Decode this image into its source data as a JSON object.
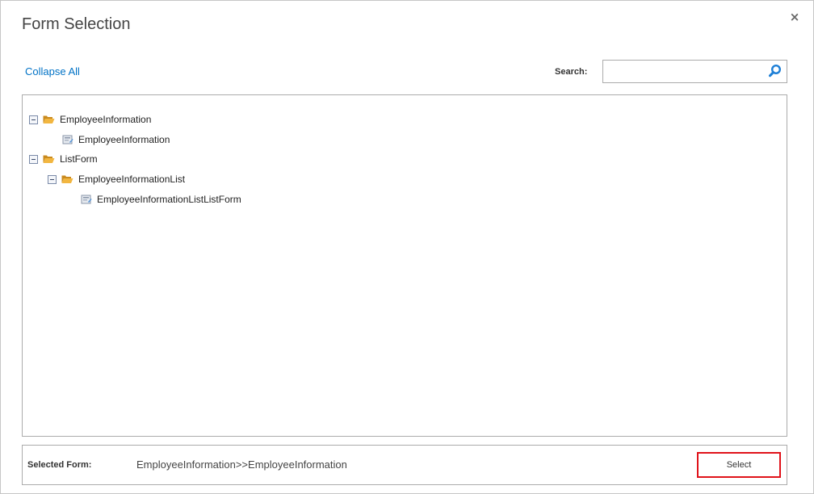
{
  "dialog": {
    "title": "Form Selection",
    "close_glyph": "×"
  },
  "toolbar": {
    "collapse_all": "Collapse All",
    "search_label": "Search:",
    "search_value": "",
    "search_icon": "search-icon"
  },
  "tree": [
    {
      "label": "EmployeeInformation",
      "type": "folder",
      "expanded": true,
      "depth": 0
    },
    {
      "label": "EmployeeInformation",
      "type": "form",
      "depth": 1
    },
    {
      "label": "ListForm",
      "type": "folder",
      "expanded": true,
      "depth": 0
    },
    {
      "label": "EmployeeInformationList",
      "type": "folder",
      "expanded": true,
      "depth": 1
    },
    {
      "label": "EmployeeInformationListListForm",
      "type": "form",
      "depth": 2
    }
  ],
  "footer": {
    "selected_label": "Selected Form:",
    "selected_value": "EmployeeInformation>>EmployeeInformation",
    "select_button": "Select"
  },
  "colors": {
    "link": "#0072c6",
    "highlight_border": "#e0121a",
    "folder": "#e8a83a"
  }
}
